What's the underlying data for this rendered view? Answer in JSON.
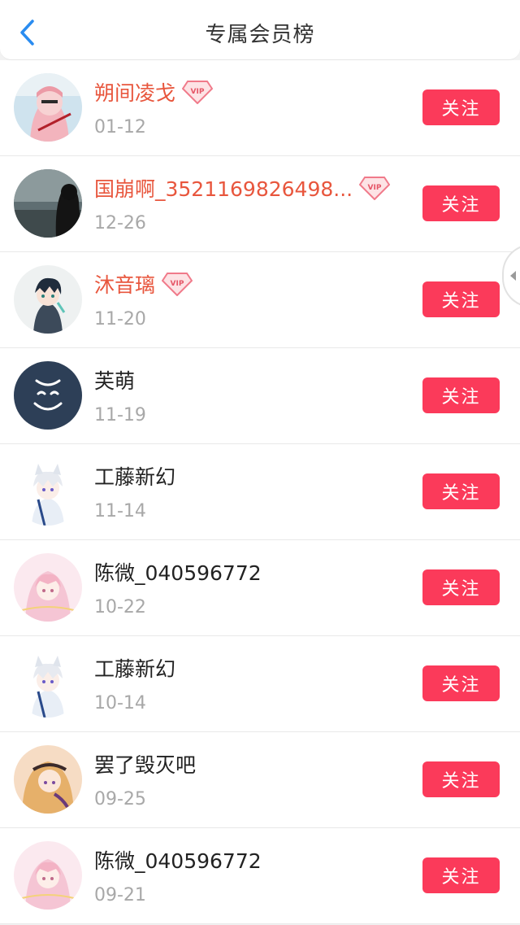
{
  "header": {
    "title": "专属会员榜",
    "back_icon": "chevron-left-icon",
    "accent": "#2a8cf0"
  },
  "colors": {
    "vip_name": "#e8563d",
    "follow_button": "#fb3a5a",
    "date": "#a8a8a8"
  },
  "members": [
    {
      "name": "朔间凌戈",
      "date": "01-12",
      "vip": true,
      "follow_label": "关注",
      "avatar": "anime-girl-pink-avatar"
    },
    {
      "name": "国崩啊_3521169826498...",
      "date": "12-26",
      "vip": true,
      "follow_label": "关注",
      "avatar": "dark-silhouette-avatar"
    },
    {
      "name": "沐音璃",
      "date": "11-20",
      "vip": true,
      "follow_label": "关注",
      "avatar": "anime-boy-avatar"
    },
    {
      "name": "芙萌",
      "date": "11-19",
      "vip": false,
      "follow_label": "关注",
      "avatar": "smiley-face-avatar"
    },
    {
      "name": "工藤新幻",
      "date": "11-14",
      "vip": false,
      "follow_label": "关注",
      "avatar": "white-hair-cat-ear-avatar"
    },
    {
      "name": "陈微_040596772",
      "date": "10-22",
      "vip": false,
      "follow_label": "关注",
      "avatar": "pink-hair-girl-avatar"
    },
    {
      "name": "工藤新幻",
      "date": "10-14",
      "vip": false,
      "follow_label": "关注",
      "avatar": "white-hair-cat-ear-avatar"
    },
    {
      "name": "罢了毁灭吧",
      "date": "09-25",
      "vip": false,
      "follow_label": "关注",
      "avatar": "blonde-girl-avatar"
    },
    {
      "name": "陈微_040596772",
      "date": "09-21",
      "vip": false,
      "follow_label": "关注",
      "avatar": "pink-hair-girl-avatar"
    }
  ]
}
